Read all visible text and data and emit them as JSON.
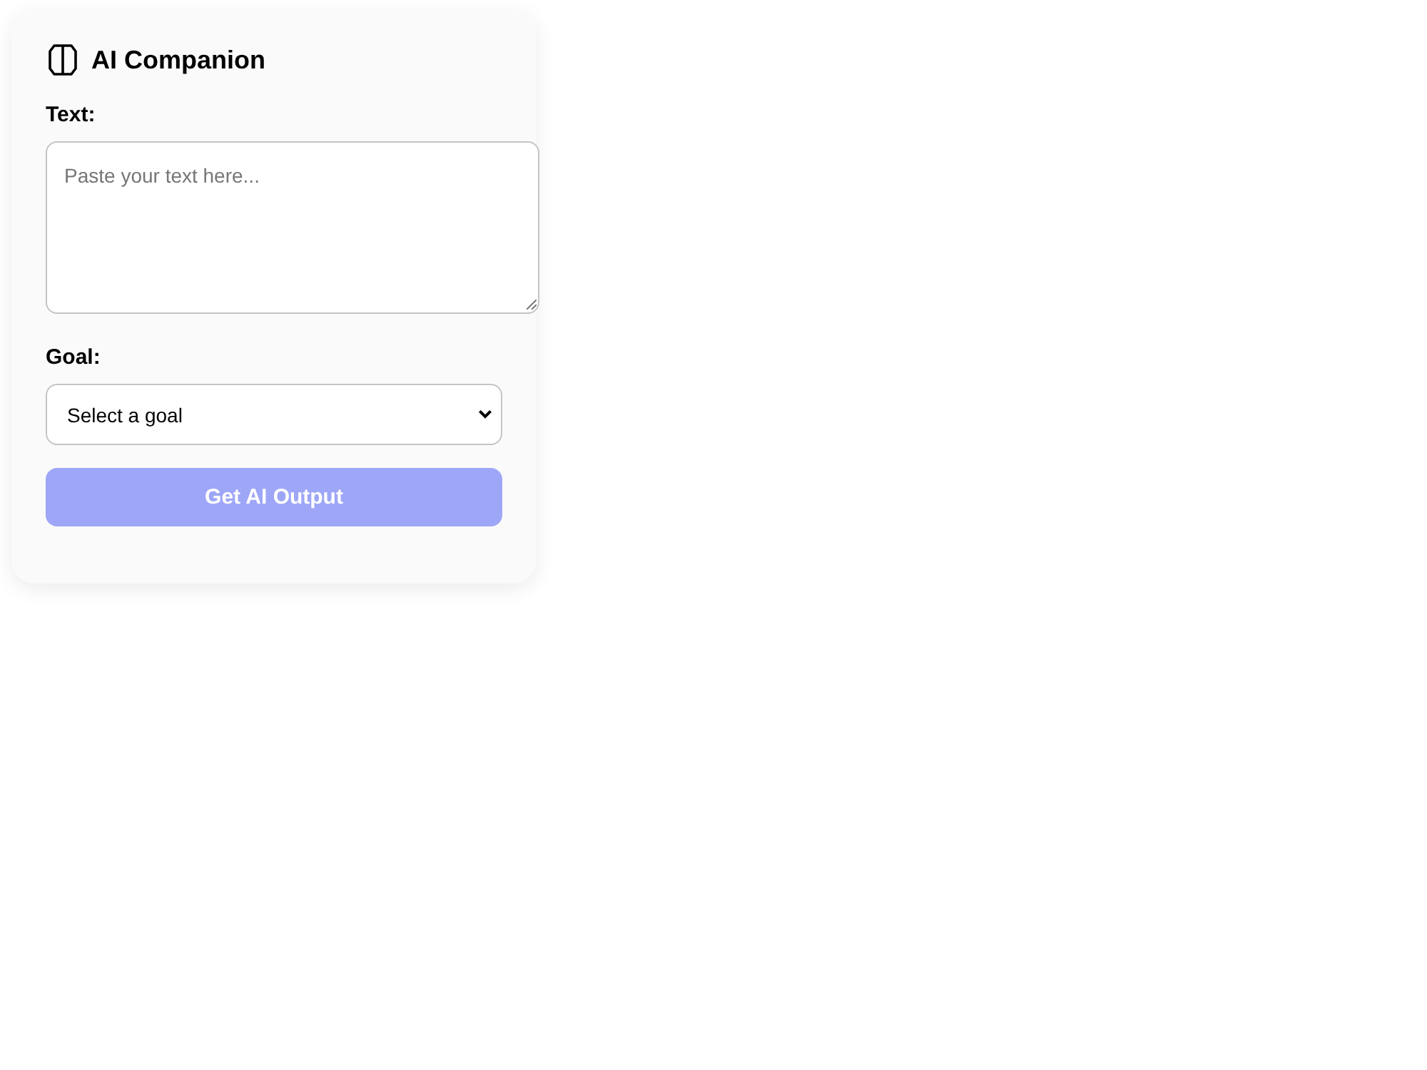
{
  "header": {
    "title": "AI Companion"
  },
  "form": {
    "fields": [
      {
        "kind": "textarea",
        "label": "Text:",
        "placeholder": "Paste your text here..."
      },
      {
        "kind": "select",
        "label": "Goal:",
        "value": "Select a goal"
      }
    ],
    "submit": {
      "label": "Get AI Output",
      "disabled": true
    }
  }
}
